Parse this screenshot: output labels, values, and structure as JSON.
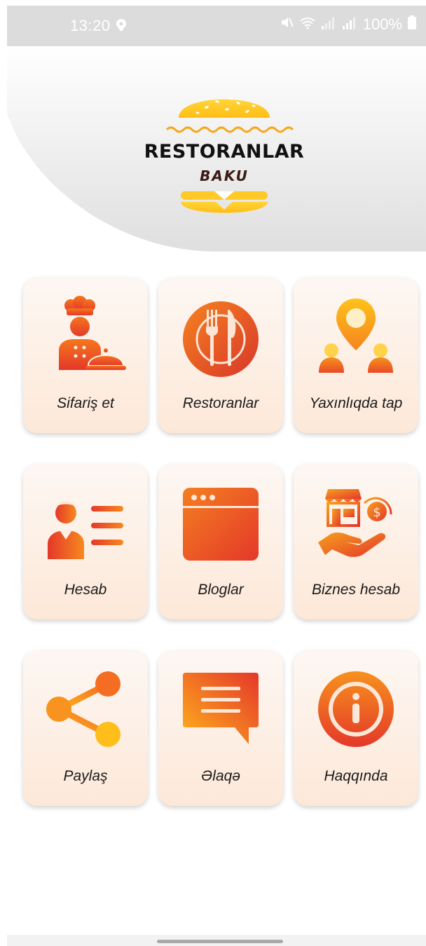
{
  "status_bar": {
    "time": "13:20",
    "battery": "100%",
    "icons": [
      "location-icon",
      "mute-icon",
      "wifi-icon",
      "signal-icon",
      "signal-icon",
      "battery-icon"
    ]
  },
  "logo": {
    "title": "RESTORANLAR",
    "subtitle": "BAKU"
  },
  "colors": {
    "accent_orange": "#f36f21",
    "accent_red": "#e33a2c",
    "accent_yellow": "#ffc31f",
    "tile_top": "#fdf7f3",
    "tile_bottom": "#fde8d8"
  },
  "menu": {
    "items": [
      {
        "label": "Sifariş et",
        "icon": "chef-icon"
      },
      {
        "label": "Restoranlar",
        "icon": "plate-cutlery-icon"
      },
      {
        "label": "Yaxınlıqda tap",
        "icon": "location-people-icon"
      },
      {
        "label": "Hesab",
        "icon": "account-icon"
      },
      {
        "label": "Bloglar",
        "icon": "browser-window-icon"
      },
      {
        "label": "Biznes hesab",
        "icon": "business-payment-icon"
      },
      {
        "label": "Paylaş",
        "icon": "share-icon"
      },
      {
        "label": "Əlaqə",
        "icon": "chat-message-icon"
      },
      {
        "label": "Haqqında",
        "icon": "info-icon"
      }
    ]
  }
}
